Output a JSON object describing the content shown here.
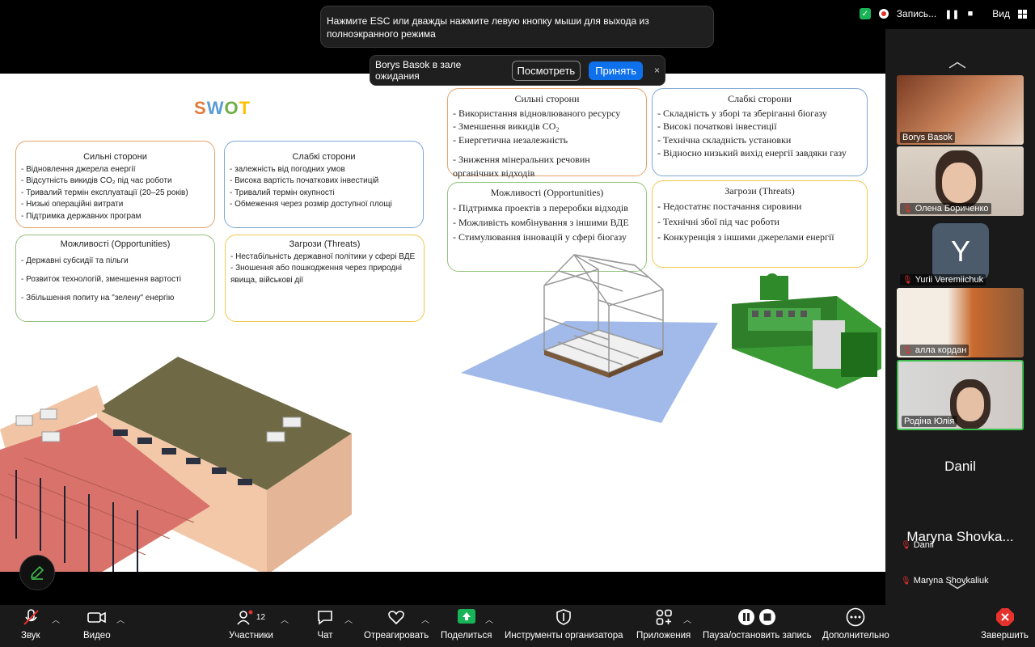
{
  "notification": {
    "esc_text": "Нажмите ESC или дважды нажмите левую кнопку мыши для выхода из полноэкранного режима"
  },
  "waiting_room": {
    "text": "Borys Basok в зале ожидания",
    "view_label": "Посмотреть",
    "accept_label": "Принять",
    "close_glyph": "×"
  },
  "top_right": {
    "recording_label": "Запись...",
    "view_label": "Вид"
  },
  "slide": {
    "title_letters": [
      "S",
      "W",
      "O",
      "T"
    ],
    "left": {
      "strengths": {
        "title": "Сильні сторони",
        "items": [
          "- Відновлення джерела енергії",
          "- Відсутність викидів CO₂ під час роботи",
          "- Тривалий термін експлуатації (20–25 років)",
          "- Низькі операційні витрати",
          "- Підтримка державних програм"
        ]
      },
      "weaknesses": {
        "title": "Слабкі сторони",
        "items": [
          "- залежність від погодних умов",
          "- Висока вартість початкових інвестицій",
          "- Тривалий термін окупності",
          "- Обмеження через розмір доступної площі"
        ]
      },
      "opportunities": {
        "title": "Можливості (Opportunities)",
        "items": [
          "- Державні субсидії та пільги",
          "- Розвиток технологій, зменшення вартості",
          "- Збільшення попиту на \"зелену\" енергію"
        ]
      },
      "threats": {
        "title": "Загрози (Threats)",
        "items": [
          "- Нестабільність державної політики у сфері ВДЕ",
          "- Зношення або пошкодження через природні",
          "явища, військові дії"
        ]
      }
    },
    "right": {
      "strengths": {
        "title": "Сильні сторони",
        "items": [
          "- Використання відновлюваного ресурсу",
          "- Зменшення викидів CO₂",
          "- Енергетична незалежність",
          "- Зниження мінеральних речовин",
          "органічних відходів"
        ]
      },
      "weaknesses": {
        "title": "Слабкі сторони",
        "items": [
          "- Складність у зборі та зберіганні біогазу",
          "- Високі початкові інвестиції",
          "- Технічна складність установки",
          "-    Відносно низький вихід енергії завдяки газу"
        ]
      },
      "opportunities": {
        "title": "Можливості (Opportunities)",
        "items": [
          "- Підтримка проектів з переробки відходів",
          "- Можливість комбінування з іншими ВДЕ",
          "- Стимулювання інновацій у сфері біогазу"
        ]
      },
      "threats": {
        "title": "Загрози (Threats)",
        "items": [
          "- Недостатнє постачання сировини",
          "- Технічні збої під час роботи",
          "- Конкуренція з іншими джерелами енергії"
        ]
      }
    }
  },
  "participants": [
    {
      "name": "Borys Basok",
      "muted": false
    },
    {
      "name": "Олена Бориченко",
      "muted": true
    },
    {
      "name": "Yurii Veremiichuk",
      "muted": true,
      "initial": "Y"
    },
    {
      "name": "алла кордан",
      "muted": true
    },
    {
      "name": "Родіна Юлія",
      "muted": false
    },
    {
      "name": "Danil",
      "muted": true,
      "big": "Danil"
    },
    {
      "name": "Maryna Shovkaliuk",
      "muted": true,
      "big": "Maryna Shovka..."
    }
  ],
  "toolbar": {
    "audio": "Звук",
    "video": "Видео",
    "participants": "Участники",
    "participants_count": "12",
    "chat": "Чат",
    "react": "Отреагировать",
    "share": "Поделиться",
    "host_tools": "Инструменты организатора",
    "apps": "Приложения",
    "pause_rec": "Пауза/остановить запись",
    "more": "Дополнительно",
    "end": "Завершить"
  },
  "colors": {
    "accent": "#0e71eb",
    "share_green": "#19b457",
    "end_red": "#e5322d",
    "active_border": "#3fbf4f"
  }
}
